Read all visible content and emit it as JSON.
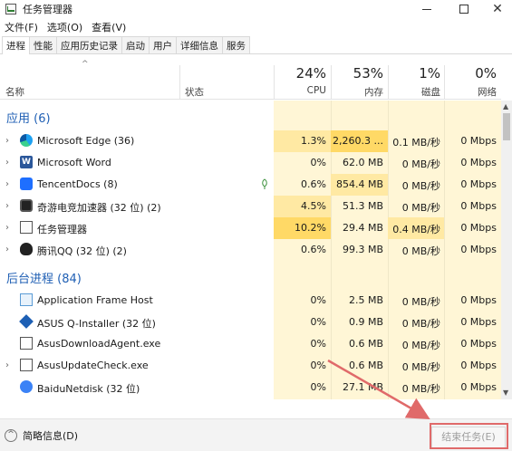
{
  "window": {
    "title": "任务管理器",
    "controls": {
      "minimize": "—",
      "maximize": "☐",
      "close": "✕"
    }
  },
  "menu": {
    "file": "文件(F)",
    "options": "选项(O)",
    "view": "查看(V)"
  },
  "tabs": [
    "进程",
    "性能",
    "应用历史记录",
    "启动",
    "用户",
    "详细信息",
    "服务"
  ],
  "header": {
    "name": "名称",
    "status": "状态",
    "cpu": {
      "pct": "24%",
      "label": "CPU"
    },
    "memory": {
      "pct": "53%",
      "label": "内存"
    },
    "disk": {
      "pct": "1%",
      "label": "磁盘"
    },
    "network": {
      "pct": "0%",
      "label": "网络"
    }
  },
  "groups": {
    "apps": "应用 (6)",
    "background": "后台进程 (84)"
  },
  "apps": [
    {
      "name": "Microsoft Edge (36)",
      "icon": "edge-icon",
      "cpu": "1.3%",
      "mem": "2,260.3 ...",
      "disk": "0.1 MB/秒",
      "net": "0 Mbps",
      "expand": true
    },
    {
      "name": "Microsoft Word",
      "icon": "word-icon",
      "cpu": "0%",
      "mem": "62.0 MB",
      "disk": "0 MB/秒",
      "net": "0 Mbps",
      "expand": true
    },
    {
      "name": "TencentDocs (8)",
      "icon": "tencent-docs-icon",
      "cpu": "0.6%",
      "mem": "854.4 MB",
      "disk": "0 MB/秒",
      "net": "0 Mbps",
      "expand": true
    },
    {
      "name": "奇游电竞加速器 (32 位) (2)",
      "icon": "qiyou-icon",
      "cpu": "4.5%",
      "mem": "51.3 MB",
      "disk": "0 MB/秒",
      "net": "0 Mbps",
      "expand": true
    },
    {
      "name": "任务管理器",
      "icon": "task-manager-icon",
      "cpu": "10.2%",
      "mem": "29.4 MB",
      "disk": "0.4 MB/秒",
      "net": "0 Mbps",
      "expand": true
    },
    {
      "name": "腾讯QQ (32 位) (2)",
      "icon": "qq-icon",
      "cpu": "0.6%",
      "mem": "99.3 MB",
      "disk": "0 MB/秒",
      "net": "0 Mbps",
      "expand": true
    }
  ],
  "background": [
    {
      "name": "Application Frame Host",
      "icon": "app-frame-host-icon",
      "cpu": "0%",
      "mem": "2.5 MB",
      "disk": "0 MB/秒",
      "net": "0 Mbps",
      "expand": false
    },
    {
      "name": "ASUS Q-Installer (32 位)",
      "icon": "asus-q-installer-icon",
      "cpu": "0%",
      "mem": "0.9 MB",
      "disk": "0 MB/秒",
      "net": "0 Mbps",
      "expand": false
    },
    {
      "name": "AsusDownloadAgent.exe",
      "icon": "asus-download-agent-icon",
      "cpu": "0%",
      "mem": "0.6 MB",
      "disk": "0 MB/秒",
      "net": "0 Mbps",
      "expand": false
    },
    {
      "name": "AsusUpdateCheck.exe",
      "icon": "asus-update-check-icon",
      "cpu": "0%",
      "mem": "0.6 MB",
      "disk": "0 MB/秒",
      "net": "0 Mbps",
      "expand": true
    },
    {
      "name": "BaiduNetdisk (32 位)",
      "icon": "baidu-netdisk-icon",
      "cpu": "0%",
      "mem": "27.1 MB",
      "disk": "0 MB/秒",
      "net": "0 Mbps",
      "expand": false
    }
  ],
  "footer": {
    "fewer_details": "简略信息(D)",
    "end_task": "结束任务(E)"
  },
  "colors": {
    "group_title": "#1f5fb4",
    "heat_light": "#fff6d6",
    "heat_mid": "#ffe9a3",
    "heat_high": "#ffd966",
    "annotation_red": "#e06a6a"
  }
}
